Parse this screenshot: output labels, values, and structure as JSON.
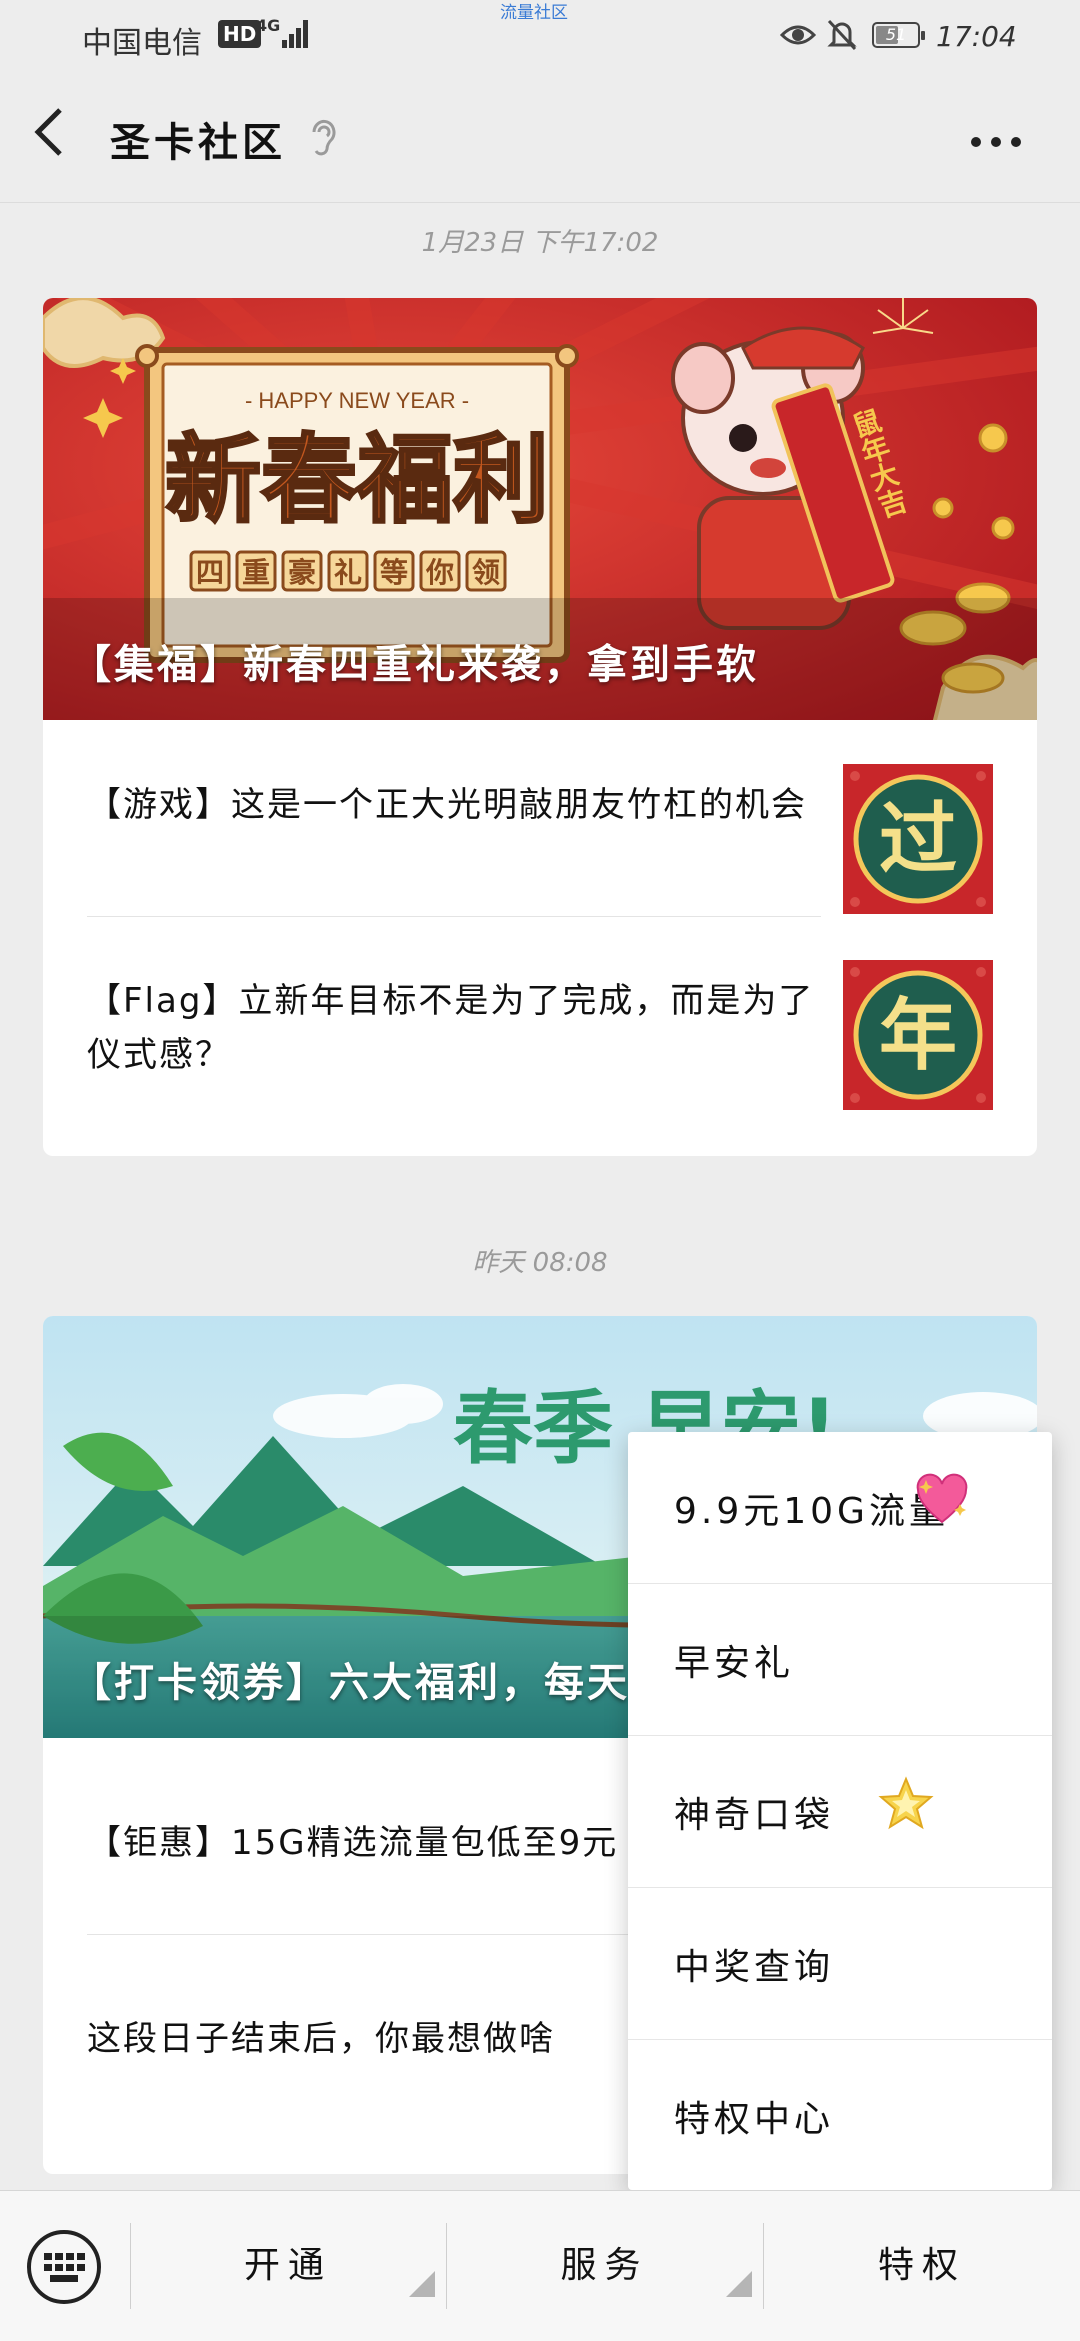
{
  "status_bar": {
    "carrier": "中国电信",
    "hd_badge": "HD",
    "network": "4G",
    "top_notice": "流量社区",
    "battery": "51",
    "time": "17:04"
  },
  "header": {
    "title": "圣卡社区"
  },
  "messages": [
    {
      "timestamp": "1月23日 下午17:02",
      "cover": {
        "headline_small": "- HAPPY NEW YEAR -",
        "headline_big": "新春福利",
        "chips": [
          "四",
          "重",
          "豪",
          "礼",
          "等",
          "你",
          "领"
        ],
        "scroll_text": "鼠年大吉",
        "caption": "【集福】新春四重礼来袭，拿到手软"
      },
      "items": [
        {
          "text": "【游戏】这是一个正大光明敲朋友竹杠的机会",
          "thumb_char": "过"
        },
        {
          "text": "【Flag】立新年目标不是为了完成，而是为了仪式感？",
          "thumb_char": "年"
        }
      ]
    },
    {
      "timestamp": "昨天 08:08",
      "cover": {
        "headline_big": "春季 早安!",
        "caption": "【打卡领券】六大福利，每天"
      },
      "items": [
        {
          "text": "【钜惠】15G精选流量包低至9元"
        },
        {
          "text": "这段日子结束后，你最想做啥"
        }
      ]
    }
  ],
  "popup_menu": {
    "items": [
      {
        "label": "9.9元10G流量",
        "icon": "sparkling-heart-icon"
      },
      {
        "label": "早安礼"
      },
      {
        "label": "神奇口袋",
        "icon": "star-icon"
      },
      {
        "label": "中奖查询"
      },
      {
        "label": "特权中心"
      }
    ]
  },
  "bottom_nav": {
    "items": [
      {
        "label": "开通"
      },
      {
        "label": "服务"
      },
      {
        "label": "特权"
      }
    ]
  },
  "colors": {
    "page_bg": "#ededed",
    "festive_red": "#c8262a",
    "gold": "#f4c75a",
    "thumb_green": "#1f5e4e"
  }
}
